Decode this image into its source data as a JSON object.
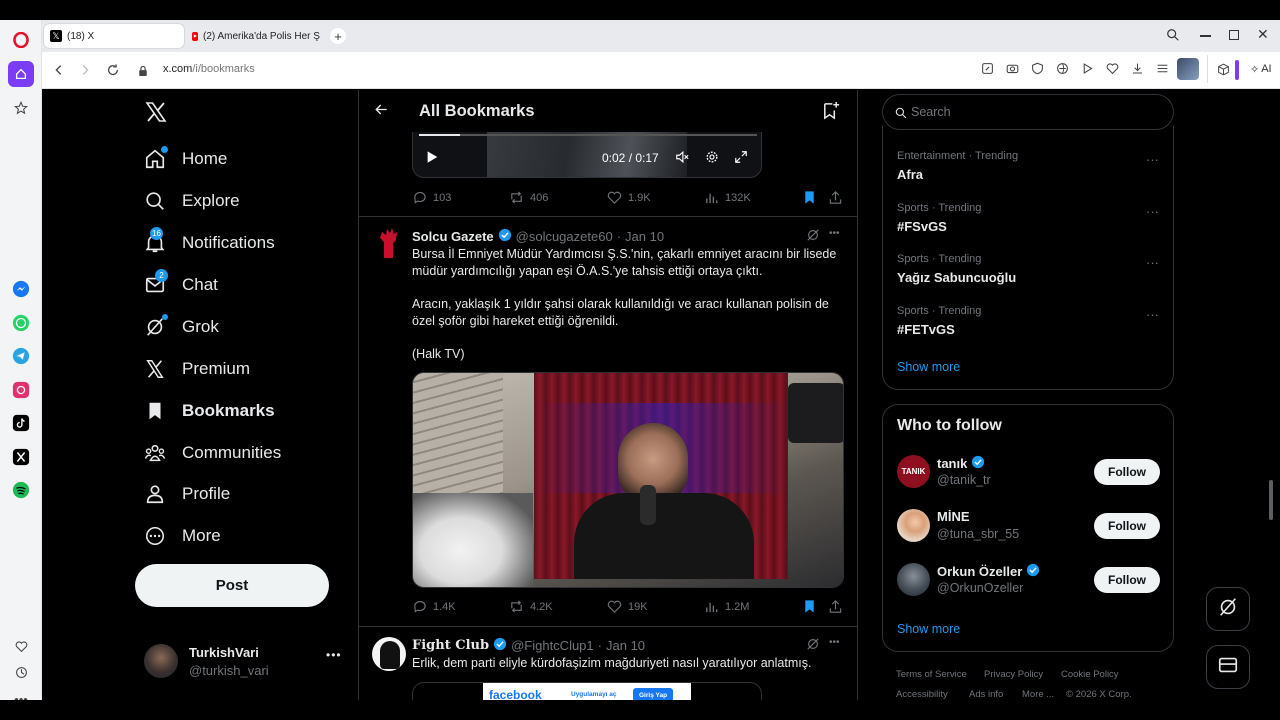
{
  "browser": {
    "tabs": [
      {
        "title": "(18) X"
      },
      {
        "title": "(2) Amerika'da Polis Her Ş..."
      }
    ],
    "url_host": "x.com",
    "url_path": "/i/bookmarks",
    "ai_label": "AI"
  },
  "nav": {
    "items": [
      {
        "label": "Home"
      },
      {
        "label": "Explore"
      },
      {
        "label": "Notifications",
        "badge": "16"
      },
      {
        "label": "Chat",
        "badge": "2"
      },
      {
        "label": "Grok"
      },
      {
        "label": "Premium"
      },
      {
        "label": "Bookmarks"
      },
      {
        "label": "Communities"
      },
      {
        "label": "Profile"
      },
      {
        "label": "More"
      }
    ],
    "post_label": "Post",
    "account": {
      "name": "TurkishVari",
      "handle": "@turkish_vari"
    }
  },
  "header": {
    "title": "All Bookmarks"
  },
  "video_top": {
    "time": "0:02 / 0:17",
    "progress": 0.12,
    "stats": {
      "replies": "103",
      "reposts": "406",
      "likes": "1.9K",
      "views": "132K"
    }
  },
  "tweet1": {
    "author": "Solcu Gazete",
    "handle": "@solcugazete60",
    "date": "Jan 10",
    "para1": "Bursa İl Emniyet Müdür Yardımcısı Ş.S.'nin, çakarlı emniyet aracını bir lisede müdür yardımcılığı yapan eşi Ö.A.S.'ye tahsis ettiği ortaya çıktı.",
    "para2": "Aracın, yaklaşık 1 yıldır şahsi olarak kullanıldığı ve aracı kullanan polisin de özel şoför gibi hareket ettiği öğrenildi.",
    "para3": "(Halk TV)",
    "stats": {
      "replies": "1.4K",
      "reposts": "4.2K",
      "likes": "19K",
      "views": "1.2M"
    }
  },
  "tweet2": {
    "author": "Fight Club",
    "handle": "@FightcClup1",
    "date": "Jan 10",
    "text": "Erlik, dem parti eliyle kürdofaşizim mağduriyeti nasıl yaratılıyor anlatmış.",
    "card_brand": "facebook",
    "card_text": "Uygulamayı aç",
    "card_button": "Giriş Yap"
  },
  "search": {
    "placeholder": "Search"
  },
  "trends": [
    {
      "category": "Entertainment · Trending",
      "name": "Afra"
    },
    {
      "category": "Sports · Trending",
      "name": "#FSvGS"
    },
    {
      "category": "Sports · Trending",
      "name": "Yağız Sabuncuoğlu"
    },
    {
      "category": "Sports · Trending",
      "name": "#FETvGS"
    }
  ],
  "trends_show_more": "Show more",
  "who_to_follow": {
    "title": "Who to follow",
    "users": [
      {
        "name": "tanık",
        "handle": "@tanik_tr",
        "avatar_text": "TANIK",
        "verified": true
      },
      {
        "name": "MİNE",
        "handle": "@tuna_sbr_55",
        "verified": false
      },
      {
        "name": "Orkun Özeller",
        "handle": "@OrkunOzeller",
        "verified": true
      }
    ],
    "follow_label": "Follow",
    "show_more": "Show more"
  },
  "footer": {
    "links": [
      "Terms of Service",
      "Privacy Policy",
      "Cookie Policy",
      "Accessibility",
      "Ads info",
      "More ...",
      "© 2026 X Corp."
    ]
  },
  "colors": {
    "accent": "#1d9bf0",
    "background": "#000000",
    "border": "#2f3336",
    "muted": "#71767b"
  }
}
